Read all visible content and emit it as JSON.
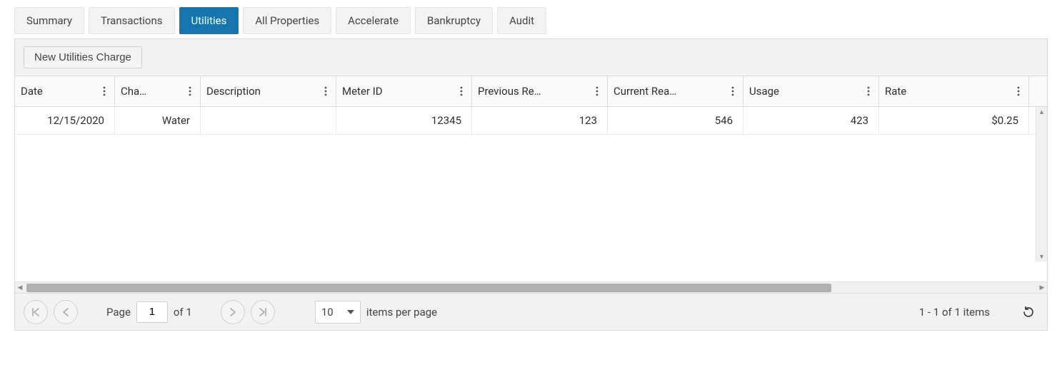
{
  "tabs": [
    {
      "label": "Summary",
      "active": false
    },
    {
      "label": "Transactions",
      "active": false
    },
    {
      "label": "Utilities",
      "active": true
    },
    {
      "label": "All Properties",
      "active": false
    },
    {
      "label": "Accelerate",
      "active": false
    },
    {
      "label": "Bankruptcy",
      "active": false
    },
    {
      "label": "Audit",
      "active": false
    }
  ],
  "toolbar": {
    "new_charge_label": "New Utilities Charge"
  },
  "grid": {
    "columns": [
      {
        "label": "Date"
      },
      {
        "label": "Cha…"
      },
      {
        "label": "Description"
      },
      {
        "label": "Meter ID"
      },
      {
        "label": "Previous Re…"
      },
      {
        "label": "Current Rea…"
      },
      {
        "label": "Usage"
      },
      {
        "label": "Rate"
      }
    ],
    "rows": [
      {
        "date": "12/15/2020",
        "charge": "Water",
        "description": "",
        "meter_id": "12345",
        "previous_reading": "123",
        "current_reading": "546",
        "usage": "423",
        "rate": "$0.25"
      }
    ]
  },
  "pager": {
    "page_label": "Page",
    "page_value": "1",
    "of_text": "of 1",
    "page_size": "10",
    "items_per_page_label": "items per page",
    "summary": "1 - 1 of 1 items"
  }
}
